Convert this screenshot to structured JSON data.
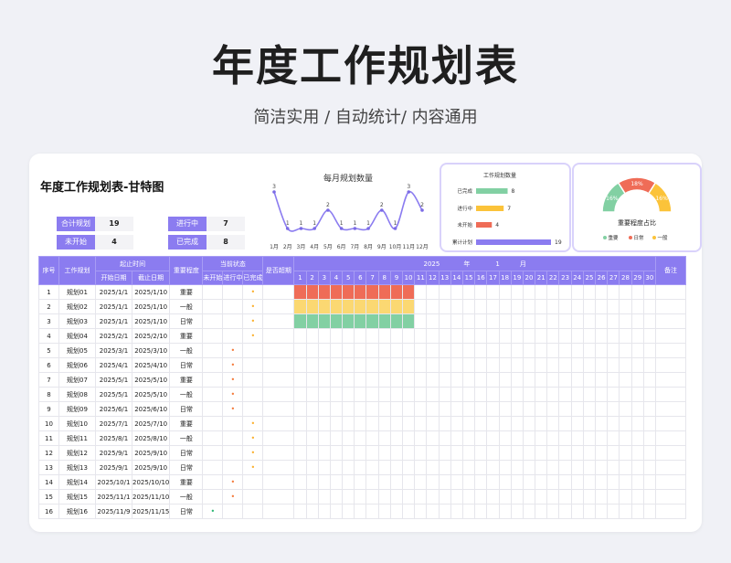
{
  "header": {
    "title": "年度工作规划表",
    "subtitle": "简洁实用 / 自动统计/ 内容通用"
  },
  "sheet_title": "年度工作规划表-甘特图",
  "stats": [
    {
      "label": "合计规划",
      "value": "19"
    },
    {
      "label": "进行中",
      "value": "7"
    },
    {
      "label": "未开始",
      "value": "4"
    },
    {
      "label": "已完成",
      "value": "8"
    }
  ],
  "colors": {
    "accent": "#8b7cf0",
    "done": "#82d0a3",
    "inprogress": "#fbc33a",
    "notstarted": "#ef6c57",
    "total": "#8b7cf0",
    "gantt_red": "#ef6c57",
    "gantt_yellow": "#fbd872",
    "gantt_green": "#82d0a3"
  },
  "chart_data": [
    {
      "type": "line",
      "title": "每月规划数量",
      "categories": [
        "1月",
        "2月",
        "3月",
        "4月",
        "5月",
        "6月",
        "7月",
        "8月",
        "9月",
        "10月",
        "11月",
        "12月"
      ],
      "values": [
        3,
        1,
        1,
        1,
        2,
        1,
        1,
        1,
        2,
        1,
        3,
        2
      ],
      "xlabel": "",
      "ylabel": "",
      "ylim": [
        0,
        4
      ]
    },
    {
      "type": "bar",
      "title": "工作规划数量",
      "categories": [
        "已完成",
        "进行中",
        "未开始",
        "累计计划"
      ],
      "values": [
        8,
        7,
        4,
        19
      ],
      "orientation": "horizontal",
      "xlim": [
        0,
        19
      ]
    },
    {
      "type": "pie",
      "title": "重要程度占比",
      "style": "half-donut",
      "slices": [
        {
          "name": "重要",
          "value": 16
        },
        {
          "name": "日常",
          "value": 18
        },
        {
          "name": "一般",
          "value": 16
        }
      ],
      "value_suffix": "%",
      "legend": "bottom"
    }
  ],
  "table": {
    "headers": {
      "seq": "序号",
      "name": "工作规划",
      "time": "起止时间",
      "start": "开始日期",
      "end": "截止日期",
      "importance": "重要程度",
      "status": "当前状态",
      "not_started": "未开始",
      "in_progress": "进行中",
      "done": "已完成",
      "overdue": "是否超期",
      "year": "2025",
      "year_unit": "年",
      "month": "1",
      "month_unit": "月",
      "note": "备注"
    },
    "days": [
      "1",
      "2",
      "3",
      "4",
      "5",
      "6",
      "7",
      "8",
      "9",
      "10",
      "11",
      "12",
      "13",
      "14",
      "15",
      "16",
      "17",
      "18",
      "19",
      "20",
      "21",
      "22",
      "23",
      "24",
      "25",
      "26",
      "27",
      "28",
      "29",
      "30"
    ],
    "status_mark": "•",
    "rows": [
      {
        "seq": "1",
        "name": "规划01",
        "start": "2025/1/1",
        "end": "2025/1/10",
        "importance": "重要",
        "status": "done",
        "gantt": "red"
      },
      {
        "seq": "2",
        "name": "规划02",
        "start": "2025/1/1",
        "end": "2025/1/10",
        "importance": "一般",
        "status": "done",
        "gantt": "yellow"
      },
      {
        "seq": "3",
        "name": "规划03",
        "start": "2025/1/1",
        "end": "2025/1/10",
        "importance": "日常",
        "status": "done",
        "gantt": "green"
      },
      {
        "seq": "4",
        "name": "规划04",
        "start": "2025/2/1",
        "end": "2025/2/10",
        "importance": "重要",
        "status": "done",
        "gantt": ""
      },
      {
        "seq": "5",
        "name": "规划05",
        "start": "2025/3/1",
        "end": "2025/3/10",
        "importance": "一般",
        "status": "in_progress",
        "gantt": ""
      },
      {
        "seq": "6",
        "name": "规划06",
        "start": "2025/4/1",
        "end": "2025/4/10",
        "importance": "日常",
        "status": "in_progress",
        "gantt": ""
      },
      {
        "seq": "7",
        "name": "规划07",
        "start": "2025/5/1",
        "end": "2025/5/10",
        "importance": "重要",
        "status": "in_progress",
        "gantt": ""
      },
      {
        "seq": "8",
        "name": "规划08",
        "start": "2025/5/1",
        "end": "2025/5/10",
        "importance": "一般",
        "status": "in_progress",
        "gantt": ""
      },
      {
        "seq": "9",
        "name": "规划09",
        "start": "2025/6/1",
        "end": "2025/6/10",
        "importance": "日常",
        "status": "in_progress",
        "gantt": ""
      },
      {
        "seq": "10",
        "name": "规划10",
        "start": "2025/7/1",
        "end": "2025/7/10",
        "importance": "重要",
        "status": "done",
        "gantt": ""
      },
      {
        "seq": "11",
        "name": "规划11",
        "start": "2025/8/1",
        "end": "2025/8/10",
        "importance": "一般",
        "status": "done",
        "gantt": ""
      },
      {
        "seq": "12",
        "name": "规划12",
        "start": "2025/9/1",
        "end": "2025/9/10",
        "importance": "日常",
        "status": "done",
        "gantt": ""
      },
      {
        "seq": "13",
        "name": "规划13",
        "start": "2025/9/1",
        "end": "2025/9/10",
        "importance": "日常",
        "status": "done",
        "gantt": ""
      },
      {
        "seq": "14",
        "name": "规划14",
        "start": "2025/10/1",
        "end": "2025/10/10",
        "importance": "重要",
        "status": "in_progress",
        "gantt": ""
      },
      {
        "seq": "15",
        "name": "规划15",
        "start": "2025/11/1",
        "end": "2025/11/10",
        "importance": "一般",
        "status": "in_progress",
        "gantt": ""
      },
      {
        "seq": "16",
        "name": "规划16",
        "start": "2025/11/9",
        "end": "2025/11/15",
        "importance": "日常",
        "status": "not_started",
        "gantt": ""
      }
    ]
  }
}
